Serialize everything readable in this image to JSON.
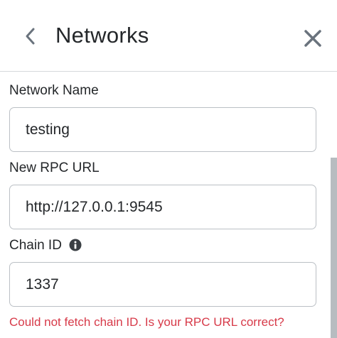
{
  "header": {
    "title": "Networks",
    "back_icon": "chevron-left-icon",
    "close_icon": "close-icon"
  },
  "form": {
    "network_name": {
      "label": "Network Name",
      "value": "testing"
    },
    "rpc_url": {
      "label": "New RPC URL",
      "value": "http://127.0.0.1:9545"
    },
    "chain_id": {
      "label": "Chain ID",
      "value": "1337",
      "info_icon": "info-icon"
    },
    "error": "Could not fetch chain ID. Is your RPC URL correct?"
  },
  "colors": {
    "text": "#24272a",
    "border": "#bbc0c5",
    "error": "#d73a49",
    "icon": "#6a737d"
  }
}
